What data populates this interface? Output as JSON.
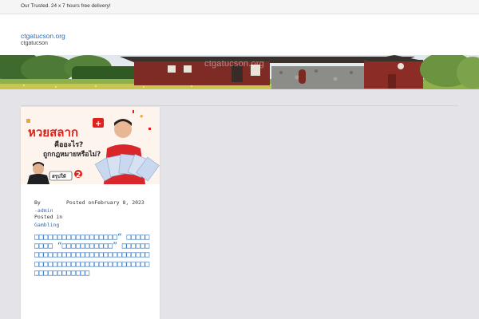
{
  "topbar": {
    "text": "Our Trusted. 24 x 7 hours free delivery!"
  },
  "header": {
    "site_title": "ctgatucson.org",
    "tagline": "ctgatucson"
  },
  "banner": {
    "watermark": "ctgatucson.org"
  },
  "post": {
    "image": {
      "brand": "หวยสลาก",
      "headline_1": "คืออะไร?",
      "headline_2": "ถูกกฎหมายหรือไม่?",
      "badge": "สรุปให้",
      "number_tag": "2",
      "colors": {
        "brand_red": "#e0201b",
        "shirt_red": "#d8262a",
        "ticket_blue": "#c9d8ef"
      }
    },
    "by_label": "By",
    "author": "-admin",
    "posted_on_label": "Posted on",
    "date": "February 8, 2023",
    "posted_in_label": "Posted in",
    "category": "Gambling",
    "title": "□□□□□□□□□□□□□□□□□□“ □□□□□□□□□ “□□□□□□□□□□□” □□□□□□□□□□□□□□□□□□□□□□□□□□□□□□□□□□□□□□□□□□□□□□□□□□□□□□□□□□□□□□□□□□□□"
  },
  "colors": {
    "link": "#2a6ebb",
    "page_bg": "#e4e4e8",
    "topbar_bg": "#f5f5f5"
  }
}
